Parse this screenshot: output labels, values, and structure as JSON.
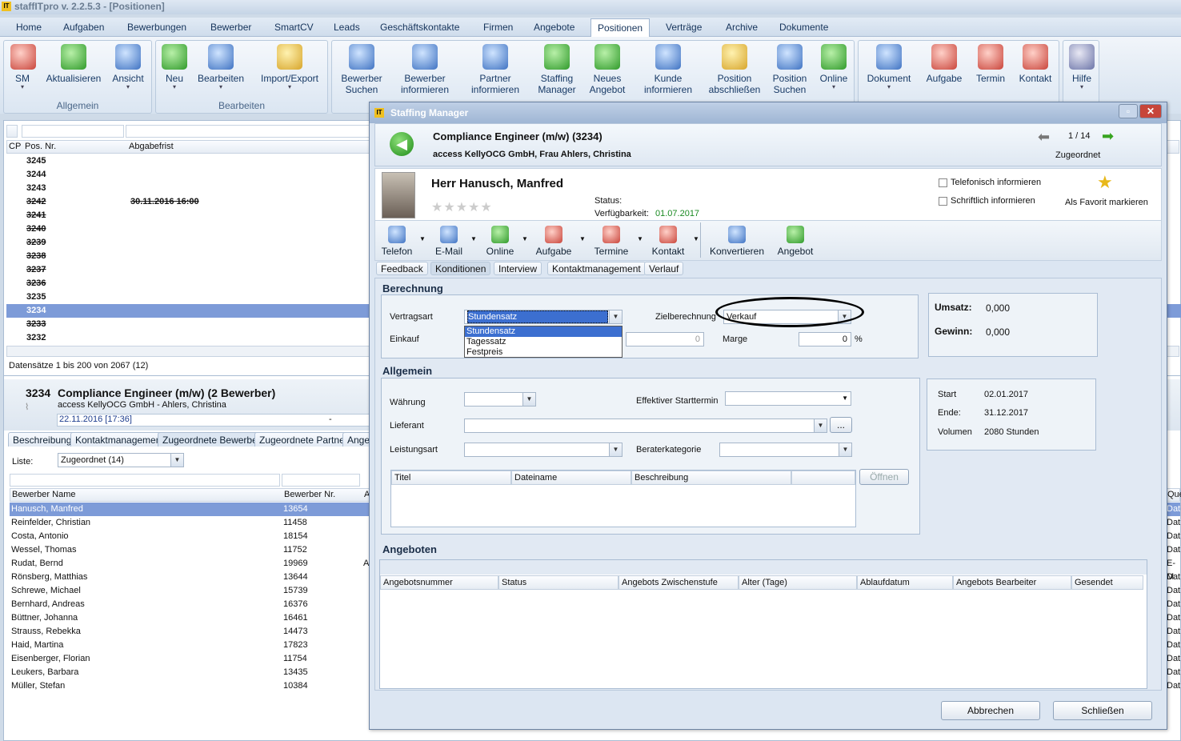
{
  "app": {
    "title": "staffITpro v. 2.2.5.3 - [Positionen]"
  },
  "menu": [
    "Home",
    "Aufgaben",
    "Bewerbungen",
    "Bewerber",
    "SmartCV",
    "Leads",
    "Geschäftskontakte",
    "Firmen",
    "Angebote",
    "Positionen",
    "Verträge",
    "Archive",
    "Dokumente"
  ],
  "ribbon": {
    "allgemein": {
      "label": "Allgemein",
      "buttons": [
        "SM",
        "Aktualisieren",
        "Ansicht"
      ]
    },
    "bearbeiten": {
      "label": "Bearbeiten",
      "buttons": [
        "Neu",
        "Bearbeiten",
        "Import/Export"
      ]
    },
    "mid": [
      "Bewerber Suchen",
      "Bewerber informieren",
      "Partner informieren",
      "Staffing Manager",
      "Neues Angebot",
      "Kunde informieren",
      "Position abschließen",
      "Position Suchen",
      "Online"
    ],
    "right": [
      "Dokument",
      "Aufgabe",
      "Termin",
      "Kontakt"
    ],
    "help": "Hilfe"
  },
  "grid": {
    "headers": {
      "cp": "CP",
      "posnr": "Pos. Nr.",
      "frist": "Abgabefrist"
    },
    "rows": [
      {
        "nr": "3245",
        "frist": "",
        "strike": false
      },
      {
        "nr": "3244",
        "frist": "",
        "strike": false
      },
      {
        "nr": "3243",
        "frist": "",
        "strike": false
      },
      {
        "nr": "3242",
        "frist": "30.11.2016 16:00",
        "strike": true
      },
      {
        "nr": "3241",
        "frist": "",
        "strike": true
      },
      {
        "nr": "3240",
        "frist": "",
        "strike": true
      },
      {
        "nr": "3239",
        "frist": "",
        "strike": true
      },
      {
        "nr": "3238",
        "frist": "",
        "strike": true
      },
      {
        "nr": "3237",
        "frist": "",
        "strike": true
      },
      {
        "nr": "3236",
        "frist": "",
        "strike": true
      },
      {
        "nr": "3235",
        "frist": "",
        "strike": false
      },
      {
        "nr": "3234",
        "frist": "",
        "strike": false,
        "selected": true
      },
      {
        "nr": "3233",
        "frist": "",
        "strike": true
      },
      {
        "nr": "3232",
        "frist": "",
        "strike": false
      }
    ],
    "status": "Datensätze 1 bis 200 von 2067 (12)"
  },
  "detail": {
    "nr": "3234",
    "title": "Compliance Engineer (m/w) (2 Bewerber)",
    "company": "access KellyOCG GmbH - Ahlers, Christina",
    "date": "22.11.2016 [17:36]",
    "dash": "-"
  },
  "detailTabs": [
    "Beschreibung",
    "Kontaktmanagement",
    "Zugeordnete Bewerber",
    "Zugeordnete Partner",
    "Angeb"
  ],
  "liste": {
    "label": "Liste:",
    "value": "Zugeordnet (14)"
  },
  "bewerberList": {
    "headers": {
      "name": "Bewerber Name",
      "nr": "Bewerber Nr.",
      "a": "A"
    },
    "rows": [
      {
        "name": "Hanusch, Manfred",
        "nr": "13654",
        "a": ""
      },
      {
        "name": "Reinfelder, Christian",
        "nr": "11458",
        "a": ""
      },
      {
        "name": "Costa, Antonio",
        "nr": "18154",
        "a": ""
      },
      {
        "name": "Wessel, Thomas",
        "nr": "11752",
        "a": ""
      },
      {
        "name": "Rudat, Bernd",
        "nr": "19969",
        "a": "A"
      },
      {
        "name": "Rönsberg, Matthias",
        "nr": "13644",
        "a": ""
      },
      {
        "name": "Schrewe, Michael",
        "nr": "15739",
        "a": ""
      },
      {
        "name": "Bernhard, Andreas",
        "nr": "16376",
        "a": ""
      },
      {
        "name": "Büttner, Johanna",
        "nr": "16461",
        "a": ""
      },
      {
        "name": "Strauss, Rebekka",
        "nr": "14473",
        "a": ""
      },
      {
        "name": "Haid, Martina",
        "nr": "17823",
        "a": ""
      },
      {
        "name": "Eisenberger, Florian",
        "nr": "11754",
        "a": ""
      },
      {
        "name": "Leukers, Barbara",
        "nr": "13435",
        "a": ""
      },
      {
        "name": "Müller, Stefan",
        "nr": "10384",
        "a": ""
      }
    ]
  },
  "rightEdge": {
    "que": "Que",
    "vals": [
      "Dat",
      "Dat",
      "Dat",
      "Dat",
      "E-M",
      "Dat",
      "Dat",
      "Dat",
      "Dat",
      "Dat",
      "Dat",
      "Dat",
      "Dat",
      "Dat"
    ]
  },
  "dialog": {
    "title": "Staffing Manager",
    "position": "Compliance Engineer (m/w) (3234)",
    "company": "access KellyOCG GmbH, Frau Ahlers, Christina",
    "pager": "1 / 14",
    "state": "Zugeordnet",
    "person": "Herr Hanusch, Manfred",
    "statusLabel": "Status:",
    "verfLabel": "Verfügbarkeit:",
    "verfValue": "01.07.2017",
    "telInfo": "Telefonisch informieren",
    "schrInfo": "Schriftlich informieren",
    "favorit": "Als Favorit markieren",
    "actions": [
      "Telefon",
      "E-Mail",
      "Online",
      "Aufgabe",
      "Termine",
      "Kontakt",
      "Konvertieren",
      "Angebot"
    ],
    "tabs": [
      "Feedback",
      "Konditionen",
      "Interview",
      "Kontaktmanagement",
      "Verlauf"
    ],
    "berechnung": {
      "title": "Berechnung",
      "vertragsart": "Vertragsart",
      "vertragsartValue": "Stundensatz",
      "options": [
        "Stundensatz",
        "Tagessatz",
        "Festpreis"
      ],
      "zielberechnung": "Zielberechnung",
      "zielValue": "Verkauf",
      "einkauf": "Einkauf",
      "einkaufValue": "0",
      "marge": "Marge",
      "margeValue": "0",
      "percent": "%",
      "umsatz": "Umsatz:",
      "umsatzValue": "0,000",
      "gewinn": "Gewinn:",
      "gewinnValue": "0,000"
    },
    "allgemein": {
      "title": "Allgemein",
      "waehrung": "Währung",
      "starttermin": "Effektiver Starttermin",
      "lieferant": "Lieferant",
      "leistungsart": "Leistungsart",
      "beraterkategorie": "Beraterkategorie",
      "docCols": [
        "Titel",
        "Dateiname",
        "Beschreibung"
      ],
      "oeffnen": "Öffnen",
      "start": "Start",
      "startValue": "02.01.2017",
      "ende": "Ende:",
      "endeValue": "31.12.2017",
      "volumen": "Volumen",
      "volumenValue": "2080 Stunden"
    },
    "angeboten": {
      "title": "Angeboten",
      "cols": [
        "Angebotsnummer",
        "Status",
        "Angebots Zwischenstufe",
        "Alter (Tage)",
        "Ablaufdatum",
        "Angebots Bearbeiter",
        "Gesendet"
      ]
    },
    "abbrechen": "Abbrechen",
    "schliessen": "Schließen",
    "ellipsis": "..."
  }
}
